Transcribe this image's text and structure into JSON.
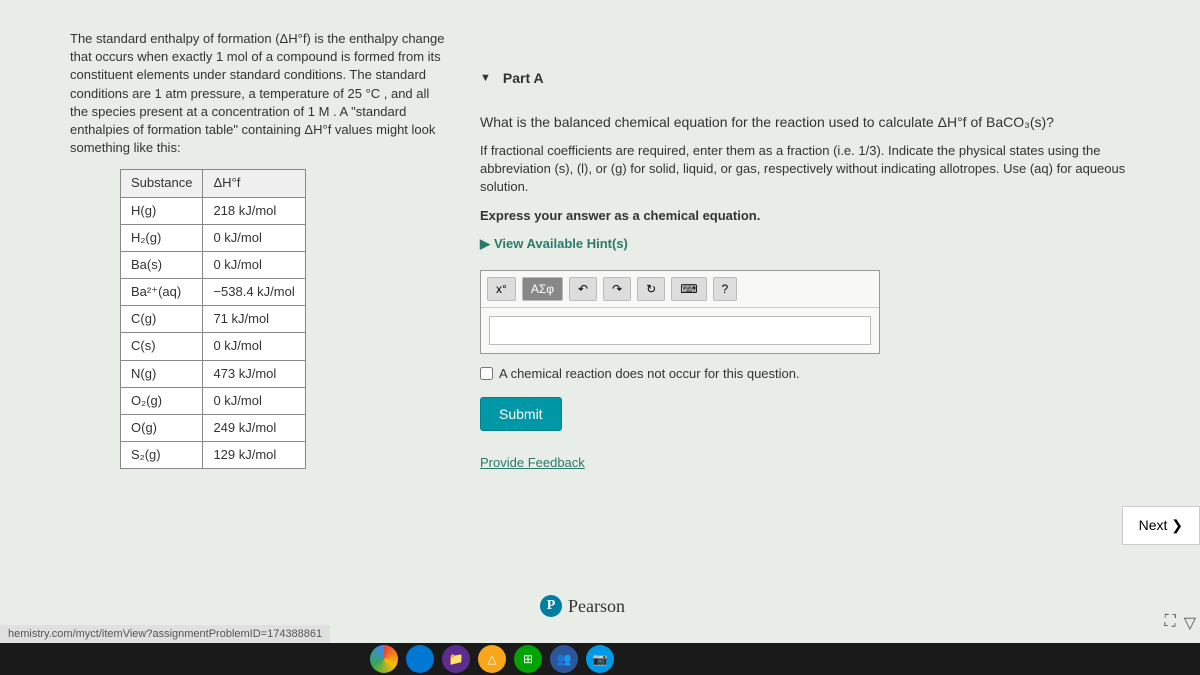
{
  "left": {
    "intro": "The standard enthalpy of formation (ΔH°f) is the enthalpy change that occurs when exactly 1 mol of a compound is formed from its constituent elements under standard conditions. The standard conditions are 1 atm pressure, a temperature of 25 °C , and all the species present at a concentration of 1 M . A \"standard enthalpies of formation table\" containing ΔH°f values might look something like this:",
    "table": {
      "col1": "Substance",
      "col2": "ΔH°f",
      "rows": [
        {
          "s": "H(g)",
          "v": "218 kJ/mol"
        },
        {
          "s": "H₂(g)",
          "v": "0 kJ/mol"
        },
        {
          "s": "Ba(s)",
          "v": "0 kJ/mol"
        },
        {
          "s": "Ba²⁺(aq)",
          "v": "−538.4 kJ/mol"
        },
        {
          "s": "C(g)",
          "v": "71 kJ/mol"
        },
        {
          "s": "C(s)",
          "v": "0 kJ/mol"
        },
        {
          "s": "N(g)",
          "v": "473 kJ/mol"
        },
        {
          "s": "O₂(g)",
          "v": "0 kJ/mol"
        },
        {
          "s": "O(g)",
          "v": "249 kJ/mol"
        },
        {
          "s": "S₂(g)",
          "v": "129 kJ/mol"
        }
      ]
    }
  },
  "right": {
    "part_label": "Part A",
    "question": "What is the balanced chemical equation for the reaction used to calculate ΔH°f of BaCO₃(s)?",
    "instruction": "If fractional coefficients are required, enter them as a fraction (i.e. 1/3). Indicate the physical states using the abbreviation (s), (l), or (g) for solid, liquid, or gas, respectively without indicating allotropes. Use (aq) for aqueous solution.",
    "express": "Express your answer as a chemical equation.",
    "hints": "View Available Hint(s)",
    "toolbar": {
      "tpl": "x°",
      "sym": "ΑΣφ",
      "undo": "↶",
      "redo": "↷",
      "reset": "↻",
      "keyboard": "⌨",
      "help": "?"
    },
    "checkbox_label": "A chemical reaction does not occur for this question.",
    "submit": "Submit",
    "feedback": "Provide Feedback",
    "next": "Next ❯"
  },
  "footer": {
    "pearson": "Pearson",
    "url": "hemistry.com/myct/itemView?assignmentProblemID=174388861"
  }
}
